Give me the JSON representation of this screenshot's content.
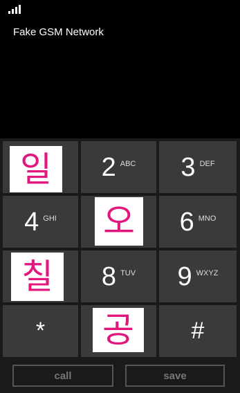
{
  "status_bar": {
    "signal_icon": "signal-strength-icon"
  },
  "network": {
    "name": "Fake GSM Network"
  },
  "keypad": {
    "keys": [
      {
        "tile": "일"
      },
      {
        "digit": "2",
        "letters": "ABC"
      },
      {
        "digit": "3",
        "letters": "DEF"
      },
      {
        "digit": "4",
        "letters": "GHI"
      },
      {
        "tile": "오"
      },
      {
        "digit": "6",
        "letters": "MNO"
      },
      {
        "tile": "칠"
      },
      {
        "digit": "8",
        "letters": "TUV"
      },
      {
        "digit": "9",
        "letters": "WXYZ"
      },
      {
        "symbol": "*"
      },
      {
        "tile": "공"
      },
      {
        "symbol": "#"
      }
    ]
  },
  "actions": {
    "call_label": "call",
    "save_label": "save"
  },
  "colors": {
    "background": "#000000",
    "key_background": "#3a3a3a",
    "accent_pink": "#e2177e",
    "tile_background": "#ffffff"
  }
}
